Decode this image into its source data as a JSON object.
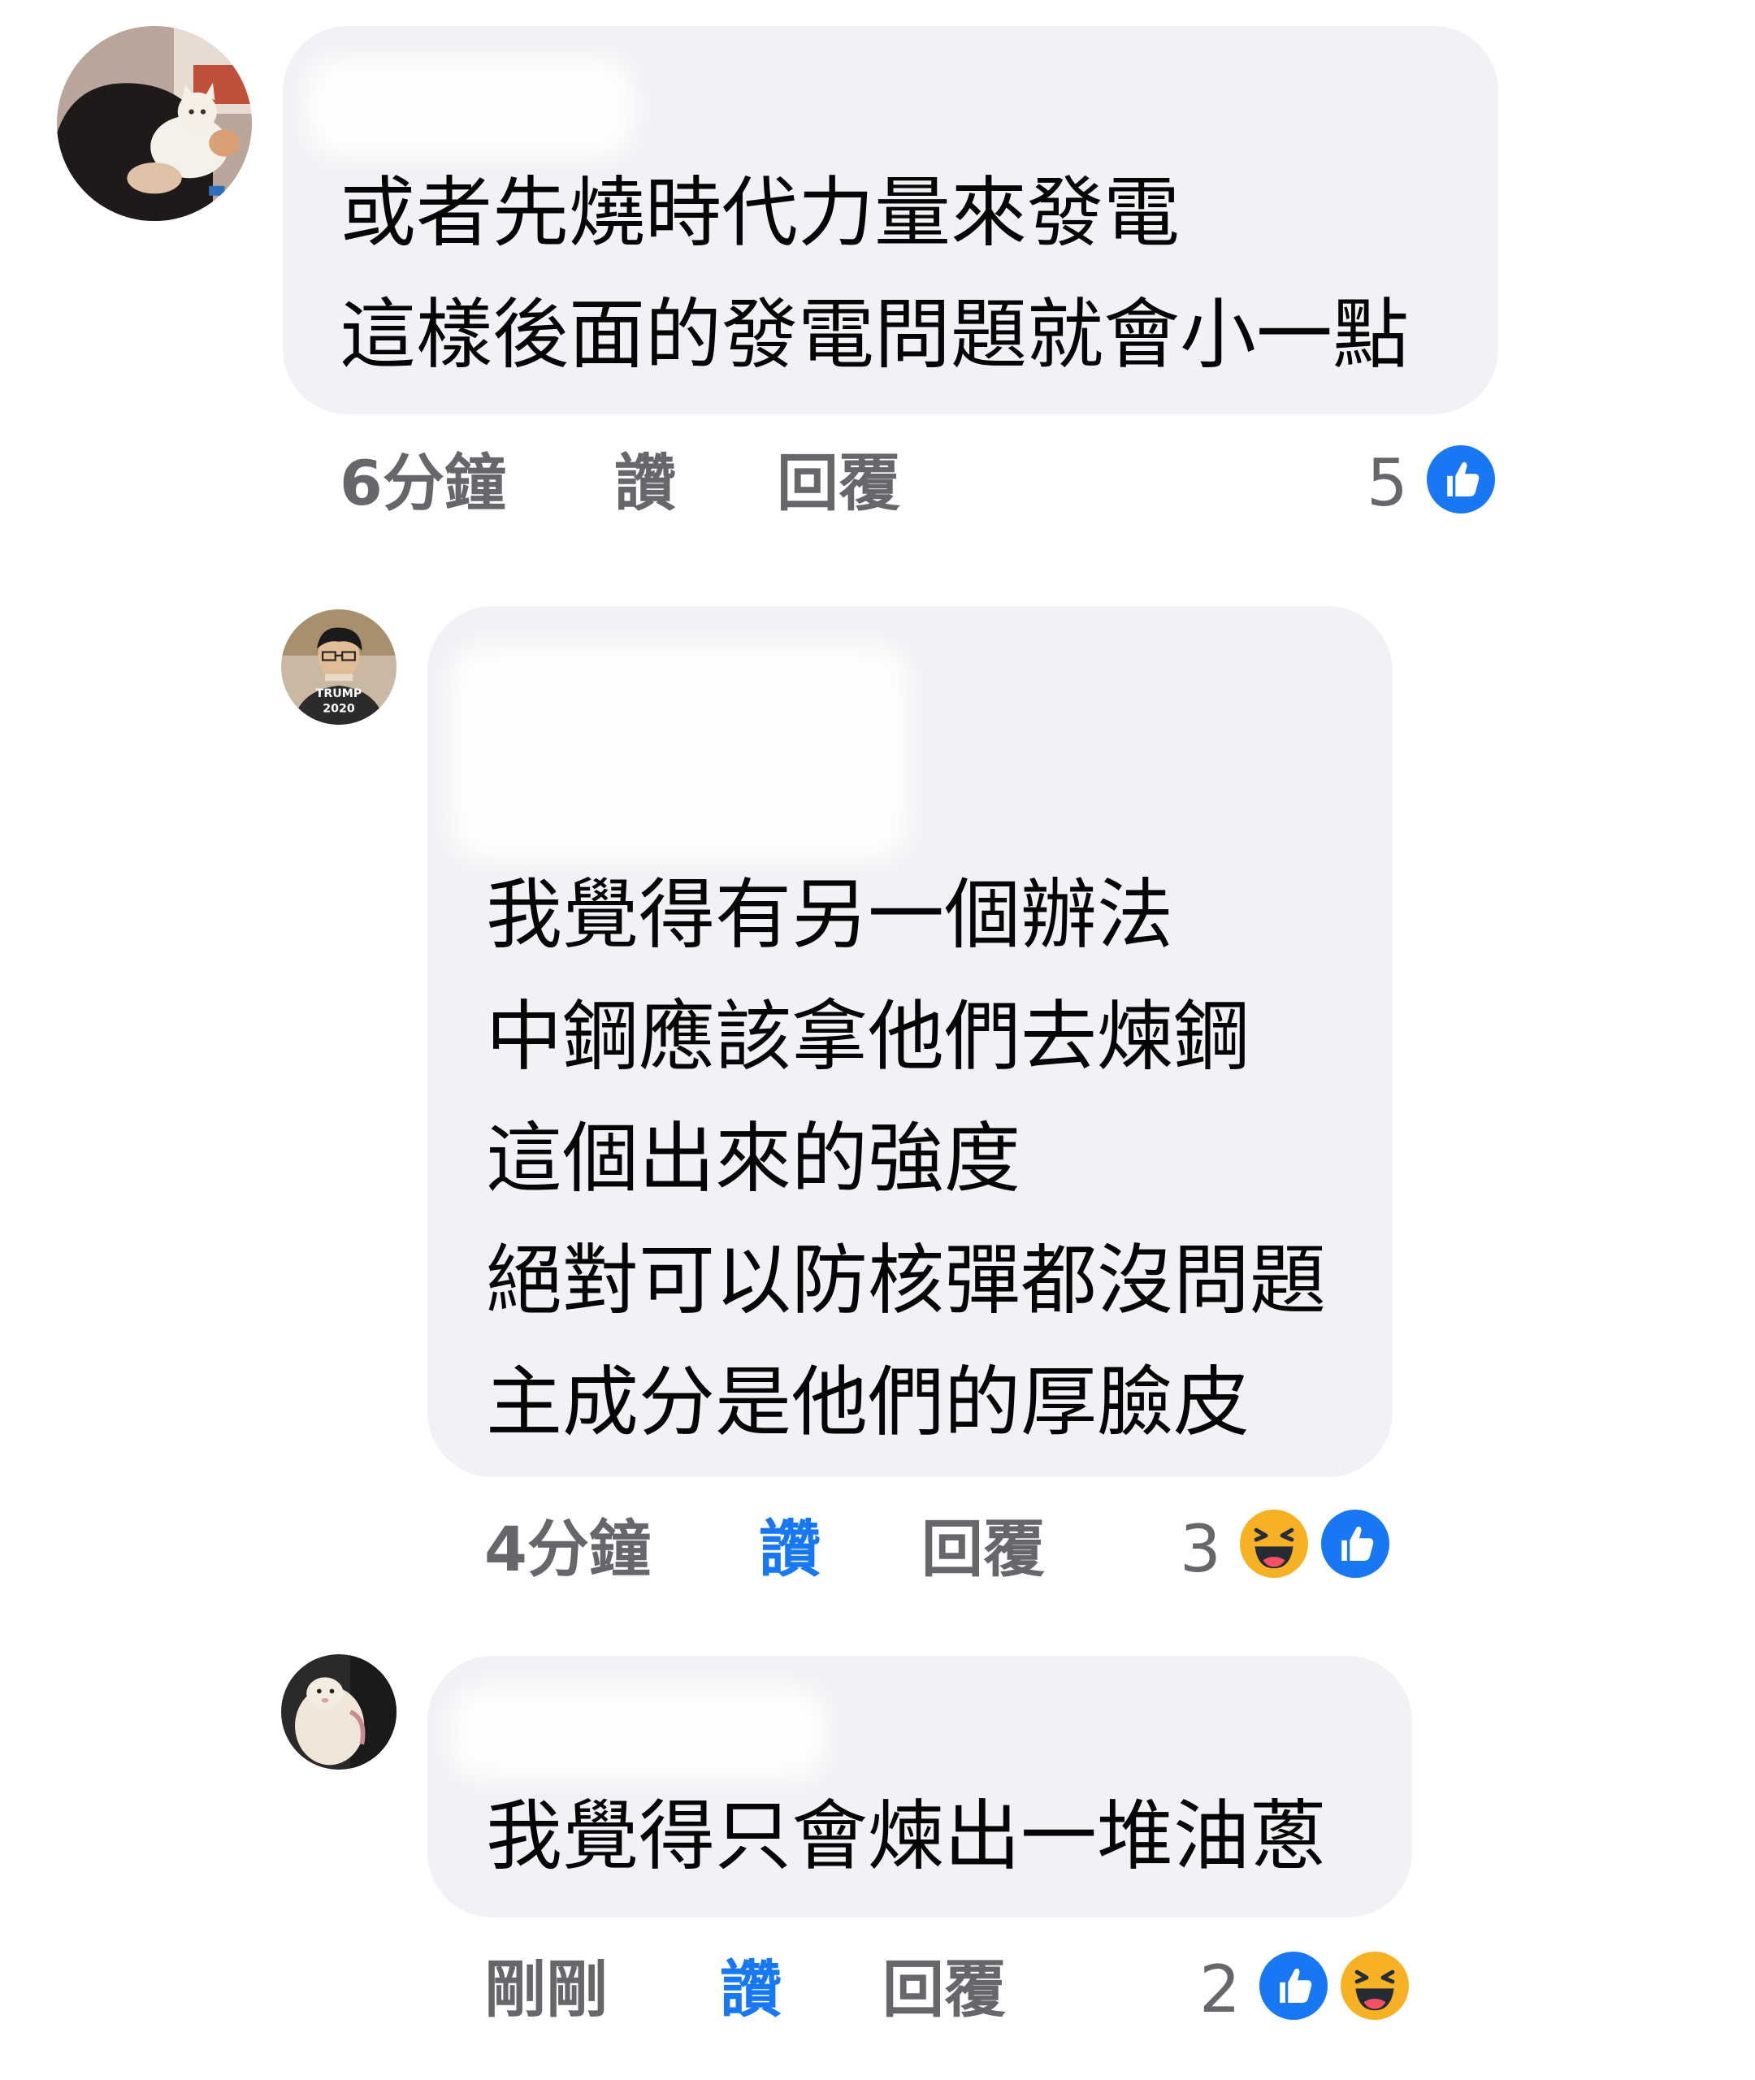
{
  "comments": [
    {
      "lines": [
        "或者先燒時代力量來發電",
        "這樣後面的發電問題就會小一點"
      ],
      "time": "6分鐘",
      "like_label": "讚",
      "reply_label": "回覆",
      "reaction_count": "5",
      "reactions": [
        "like-icon"
      ],
      "liked": false
    },
    {
      "lines": [
        "我覺得有另一個辦法",
        "中鋼應該拿他們去煉鋼",
        "這個出來的強度",
        "絕對可以防核彈都沒問題",
        "主成分是他們的厚臉皮"
      ],
      "avatar_text": [
        "TRUMP",
        "2020"
      ],
      "time": "4分鐘",
      "like_label": "讚",
      "reply_label": "回覆",
      "reaction_count": "3",
      "reactions": [
        "haha-icon",
        "like-icon"
      ],
      "liked": true
    },
    {
      "lines": [
        "我覺得只會煉出一堆油蔥"
      ],
      "time": "剛剛",
      "like_label": "讚",
      "reply_label": "回覆",
      "reaction_count": "2",
      "reactions": [
        "like-icon",
        "haha-icon"
      ],
      "liked": true
    }
  ],
  "colors": {
    "bubble": "#f0f2f5",
    "text": "#050505",
    "secondary": "#65676b",
    "like_blue": "#1877f2",
    "haha_yellow": "#f7b125"
  }
}
